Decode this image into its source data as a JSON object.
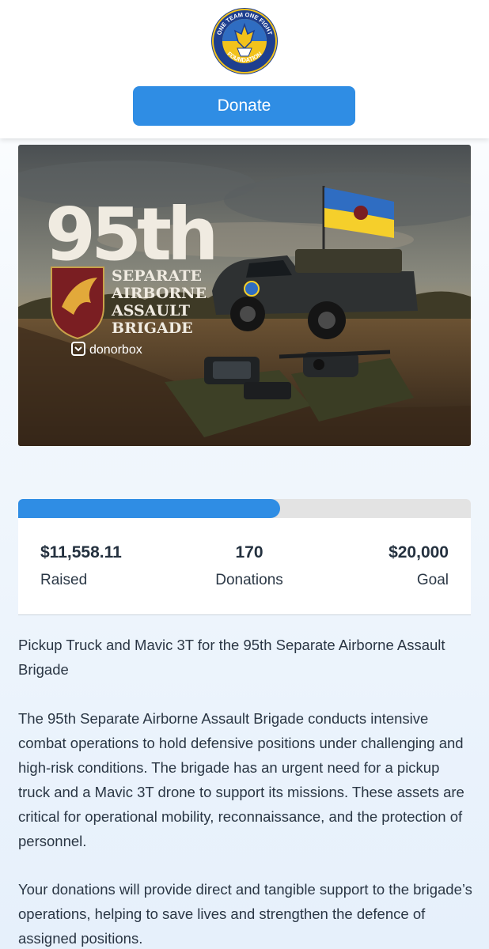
{
  "header": {
    "logo_text_top": "ONE TEAM ONE FIGHT",
    "logo_text_bottom": "FOUNDATION",
    "donate_label": "Donate"
  },
  "hero": {
    "big_number": "95th",
    "brigade_lines": [
      "SEPARATE",
      "AIRBORNE",
      "ASSAULT",
      "BRIGADE"
    ],
    "platform": "donorbox"
  },
  "stats": {
    "progress_fraction": 0.578,
    "raised_value": "$11,558.11",
    "raised_label": "Raised",
    "donations_value": "170",
    "donations_label": "Donations",
    "goal_value": "$20,000",
    "goal_label": "Goal"
  },
  "description": {
    "title": "Pickup Truck and Mavic 3T for the 95th Separate Airborne Assault Brigade",
    "paragraph1": "The 95th Separate Airborne Assault Brigade conducts intensive combat operations to hold defensive positions under challenging and high-risk conditions. The brigade has an urgent need for a pickup truck and a Mavic 3T drone to support its missions. These assets are critical for operational mobility, reconnaissance, and the protection of personnel.",
    "paragraph2": "Your donations will provide direct and tangible support to the brigade’s operations, helping to save lives and strengthen the defence of assigned positions."
  },
  "colors": {
    "accent": "#2f8de4",
    "flag_blue": "#2f6dc2",
    "flag_yellow": "#f5cf2b",
    "emblem_maroon": "#7a1e22"
  }
}
